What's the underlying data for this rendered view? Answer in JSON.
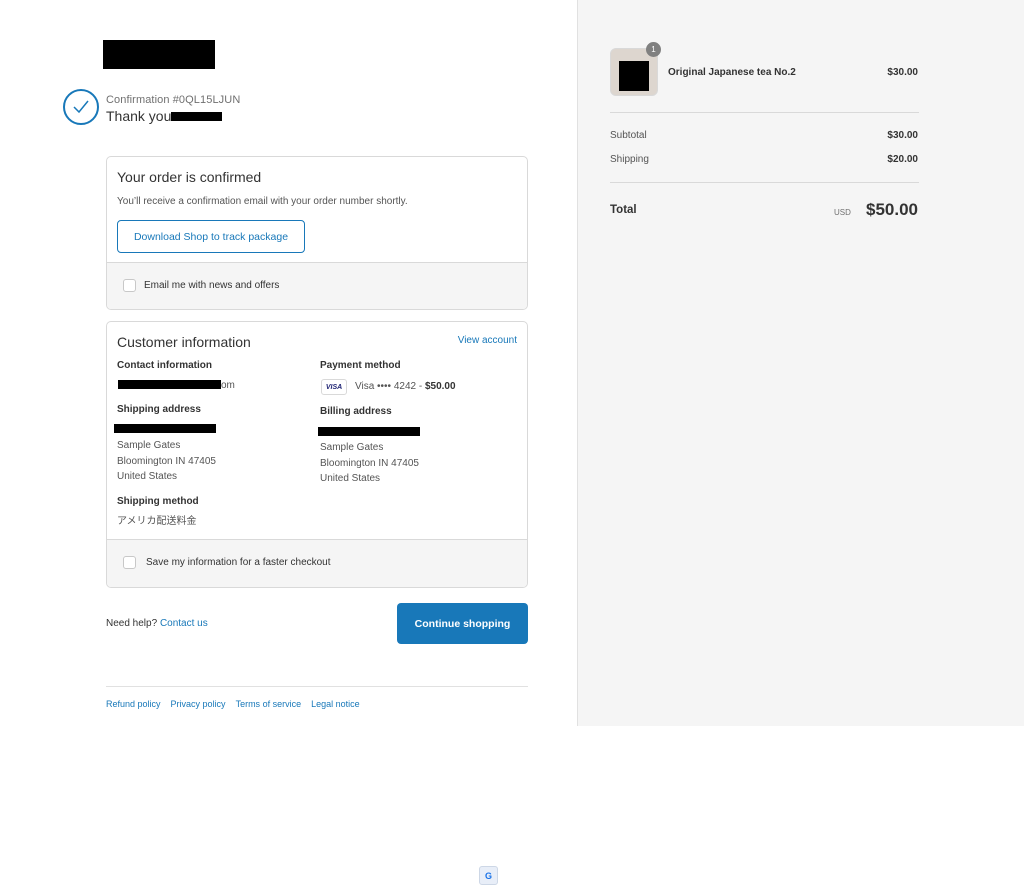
{
  "header": {
    "confirmation_number": "Confirmation #0QL15LJUN",
    "thank_you": "Thank you"
  },
  "order_panel": {
    "title": "Your order is confirmed",
    "message": "You’ll receive a confirmation email with your order number shortly.",
    "track_button": "Download Shop to track package",
    "email_opt_in_label": "Email me with news and offers"
  },
  "customer_panel": {
    "title": "Customer information",
    "view_account": "View account",
    "contact_heading": "Contact information",
    "contact_email_suffix": "om",
    "shipping_address_heading": "Shipping address",
    "shipping_address": [
      "Sample Gates",
      "Bloomington IN 47405",
      "United States"
    ],
    "shipping_method_heading": "Shipping method",
    "shipping_method": "アメリカ配送料金",
    "payment_heading": "Payment method",
    "payment_card_brand": "VISA",
    "payment_desc": "Visa •••• 4242 - ",
    "payment_amount": "$50.00",
    "billing_heading": "Billing address",
    "billing_address": [
      "Sample Gates",
      "Bloomington IN 47405",
      "United States"
    ],
    "save_info_label": "Save my information for a faster checkout"
  },
  "help": {
    "prefix": "Need help?",
    "contact": "Contact us"
  },
  "continue_button": "Continue shopping",
  "footer_links": [
    "Refund policy",
    "Privacy policy",
    "Terms of service",
    "Legal notice"
  ],
  "summary": {
    "product_name": "Original Japanese tea No.2",
    "product_price": "$30.00",
    "quantity": "1",
    "subtotal_label": "Subtotal",
    "subtotal_value": "$30.00",
    "shipping_label": "Shipping",
    "shipping_value": "$20.00",
    "total_label": "Total",
    "currency": "USD",
    "total_value": "$50.00"
  },
  "colors": {
    "accent": "#1878b9",
    "sidebar_bg": "#f5f5f5"
  }
}
